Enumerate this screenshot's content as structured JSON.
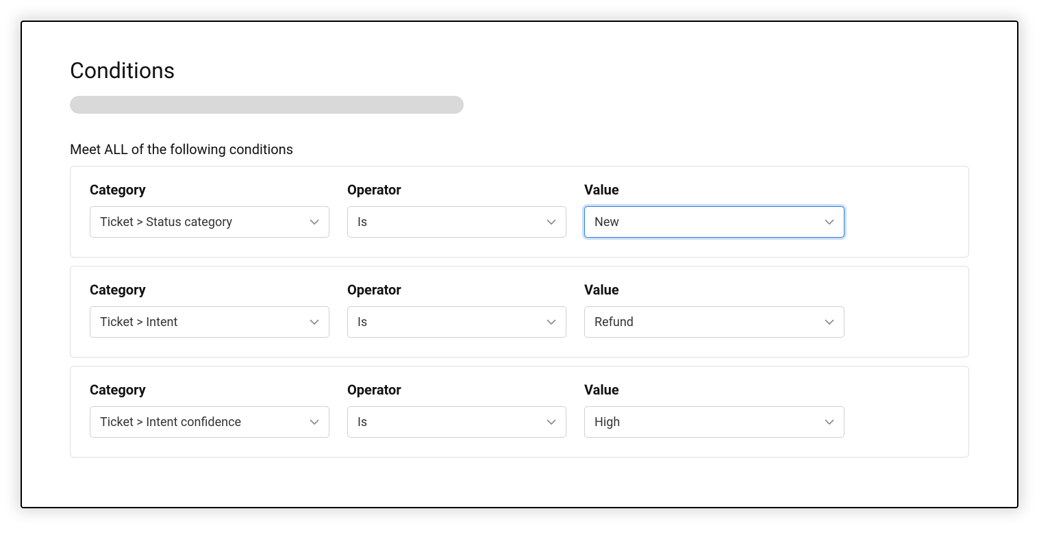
{
  "title": "Conditions",
  "subtitle": "Meet ALL of the following conditions",
  "labels": {
    "category": "Category",
    "operator": "Operator",
    "value": "Value"
  },
  "conditions": [
    {
      "category": "Ticket > Status category",
      "operator": "Is",
      "value": "New",
      "value_focused": true
    },
    {
      "category": "Ticket > Intent",
      "operator": "Is",
      "value": "Refund",
      "value_focused": false
    },
    {
      "category": "Ticket > Intent confidence",
      "operator": "Is",
      "value": "High",
      "value_focused": false
    }
  ]
}
